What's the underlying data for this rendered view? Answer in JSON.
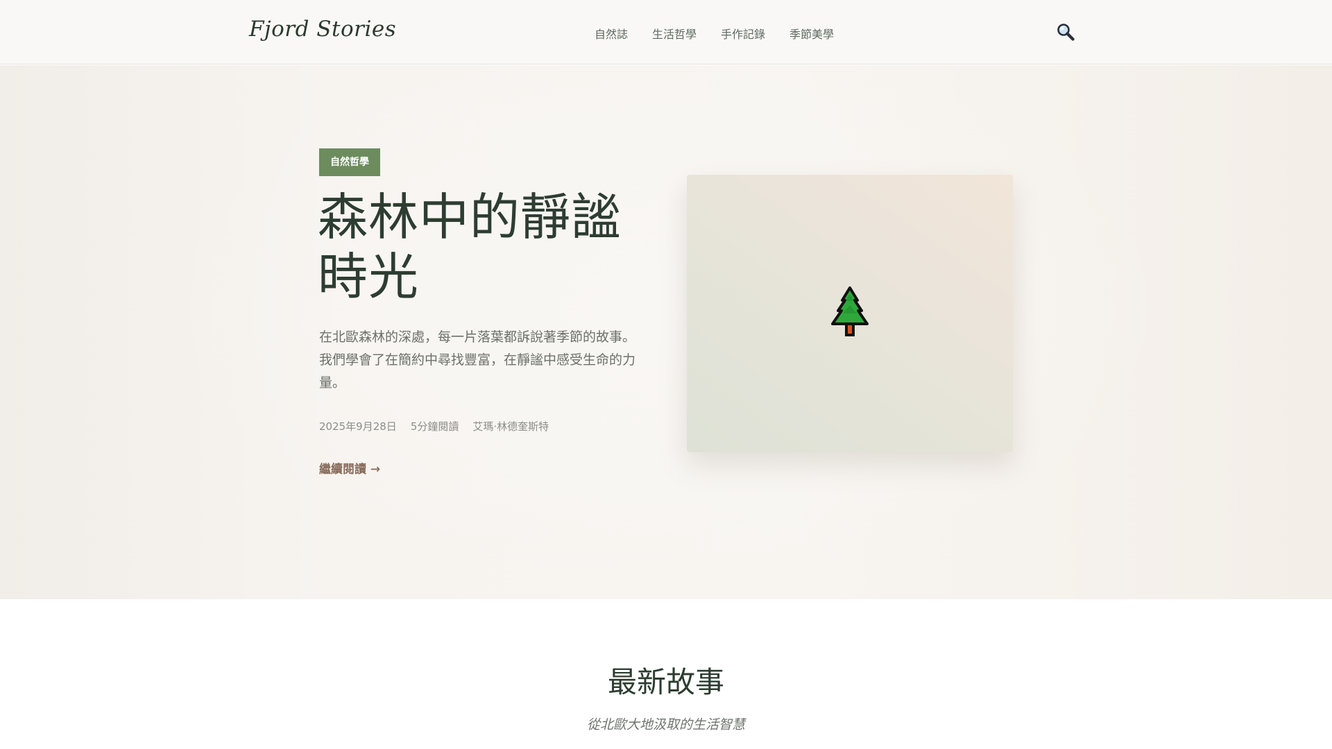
{
  "header": {
    "logo": "Fjord Stories",
    "nav": [
      "自然誌",
      "生活哲學",
      "手作記錄",
      "季節美學"
    ],
    "search_icon": "magnifier-icon"
  },
  "hero": {
    "category": "自然哲學",
    "title": "森林中的靜謐時光",
    "excerpt": "在北歐森林的深處，每一片落葉都訴說著季節的故事。 我們學會了在簡約中尋找豐富，在靜謐中感受生命的力量。",
    "meta": {
      "date": "2025年9月28日",
      "read_time": "5分鐘閱讀",
      "author": "艾瑪·林德奎斯特"
    },
    "read_more": "繼續閱讀 →",
    "image_icon": "evergreen-tree-icon"
  },
  "latest": {
    "title": "最新故事",
    "subtitle": "從北歐大地汲取的生活智慧"
  },
  "colors": {
    "accent_green": "#6c8c5e",
    "link_brown": "#8a6f5e",
    "heading": "#2d3d31"
  }
}
